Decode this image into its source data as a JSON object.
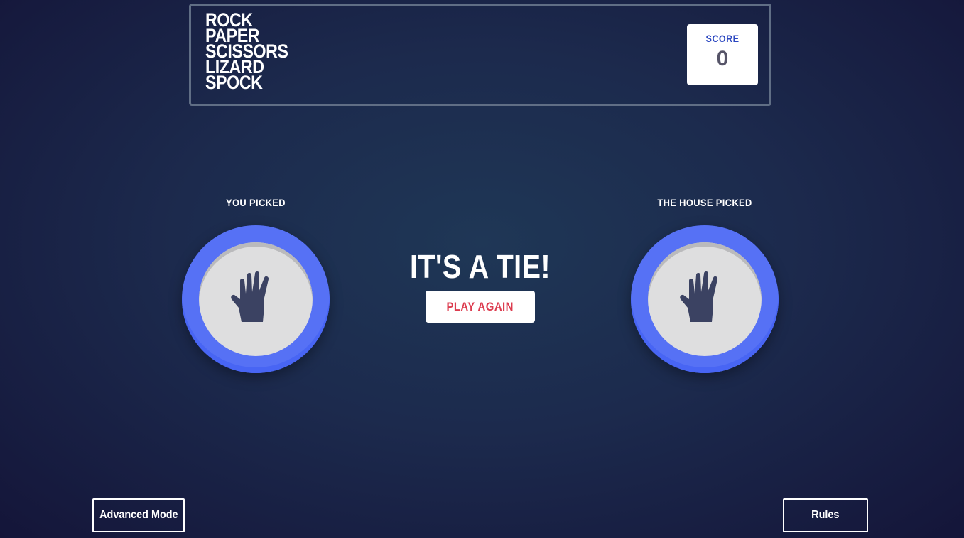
{
  "header": {
    "logo_lines": [
      "ROCK",
      "PAPER",
      "SCISSORS",
      "LIZARD",
      "SPOCK"
    ],
    "score_label": "SCORE",
    "score_value": "0"
  },
  "game": {
    "player_label": "YOU PICKED",
    "house_label": "THE HOUSE PICKED",
    "player_choice": "paper",
    "house_choice": "paper",
    "player_icon": "hand-paper-icon",
    "house_icon": "hand-paper-icon",
    "result_text": "IT'S A TIE!",
    "play_again_label": "PLAY AGAIN"
  },
  "footer": {
    "advanced_mode_label": "Advanced Mode",
    "rules_label": "Rules"
  },
  "colors": {
    "paper_ring": "#5671f5",
    "token_face": "#dededf",
    "score_label": "#2a46c0",
    "play_again_text": "#dc3c4f",
    "header_border": "#606e85",
    "hand_icon": "#3b4262"
  }
}
